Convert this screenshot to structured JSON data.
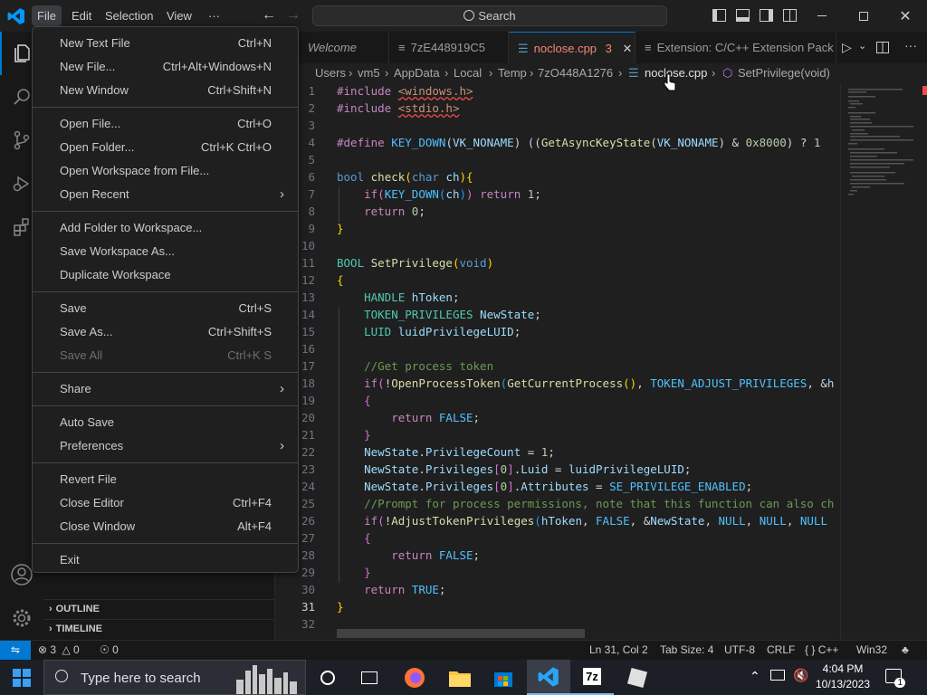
{
  "titlebar": {
    "menus": [
      "File",
      "Edit",
      "Selection",
      "View",
      "···"
    ],
    "search_label": "Search"
  },
  "sidebar": {
    "sections": [
      "OUTLINE",
      "TIMELINE"
    ]
  },
  "tabs": [
    {
      "label": "Welcome"
    },
    {
      "label": "7zE448919C5"
    },
    {
      "label": "noclose.cpp",
      "badge": "3"
    },
    {
      "label": "Extension: C/C++ Extension Pack"
    }
  ],
  "breadcrumb": [
    "Users",
    "vm5",
    "AppData",
    "Local",
    "Temp",
    "7zO448A1276",
    "noclose.cpp",
    "SetPrivilege(void)"
  ],
  "editor": {
    "line_numbers": [
      "1",
      "2",
      "3",
      "4",
      "5",
      "6",
      "7",
      "8",
      "9",
      "10",
      "11",
      "12",
      "13",
      "14",
      "15",
      "16",
      "17",
      "18",
      "19",
      "20",
      "21",
      "22",
      "23",
      "24",
      "25",
      "26",
      "27",
      "28",
      "29",
      "30",
      "31",
      "32"
    ],
    "current_line": "31",
    "lines": [
      [
        [
          "pp",
          "#include "
        ],
        [
          "st2 squig",
          "<windows.h>"
        ]
      ],
      [
        [
          "pp",
          "#include "
        ],
        [
          "st2 squig",
          "<stdio.h>"
        ]
      ],
      [],
      [
        [
          "pp",
          "#define "
        ],
        [
          "mac",
          "KEY_DOWN"
        ],
        [
          "op",
          "("
        ],
        [
          "va",
          "VK_NONAME"
        ],
        [
          "op",
          ") (("
        ],
        [
          "fn",
          "GetAsyncKeyState"
        ],
        [
          "op",
          "("
        ],
        [
          "va",
          "VK_NONAME"
        ],
        [
          "op",
          ") & "
        ],
        [
          "nu",
          "0x8000"
        ],
        [
          "op",
          ") ? "
        ],
        [
          "nu",
          "1"
        ]
      ],
      [],
      [
        [
          "kw",
          "bool "
        ],
        [
          "fn",
          "check"
        ],
        [
          "br",
          "("
        ],
        [
          "kw",
          "char "
        ],
        [
          "va",
          "ch"
        ],
        [
          "br",
          ")"
        ],
        [
          "br",
          "{"
        ]
      ],
      [
        [
          "op",
          "    "
        ],
        [
          "pp",
          "if"
        ],
        [
          "br2",
          "("
        ],
        [
          "mac",
          "KEY_DOWN"
        ],
        [
          "br3",
          "("
        ],
        [
          "va",
          "ch"
        ],
        [
          "br3",
          ")"
        ],
        [
          "br2",
          ")"
        ],
        [
          "pp",
          " return "
        ],
        [
          "nu",
          "1"
        ],
        [
          "op",
          ";"
        ]
      ],
      [
        [
          "op",
          "    "
        ],
        [
          "pp",
          "return "
        ],
        [
          "nu",
          "0"
        ],
        [
          "op",
          ";"
        ]
      ],
      [
        [
          "br",
          "}"
        ]
      ],
      [],
      [
        [
          "ty",
          "BOOL "
        ],
        [
          "fn",
          "SetPrivilege"
        ],
        [
          "br",
          "("
        ],
        [
          "kw",
          "void"
        ],
        [
          "br",
          ")"
        ]
      ],
      [
        [
          "br",
          "{"
        ]
      ],
      [
        [
          "op",
          "    "
        ],
        [
          "ty",
          "HANDLE "
        ],
        [
          "va",
          "hToken"
        ],
        [
          "op",
          ";"
        ]
      ],
      [
        [
          "op",
          "    "
        ],
        [
          "ty",
          "TOKEN_PRIVILEGES "
        ],
        [
          "va",
          "NewState"
        ],
        [
          "op",
          ";"
        ]
      ],
      [
        [
          "op",
          "    "
        ],
        [
          "ty",
          "LUID "
        ],
        [
          "va",
          "luidPrivilegeLUID"
        ],
        [
          "op",
          ";"
        ]
      ],
      [],
      [
        [
          "op",
          "    "
        ],
        [
          "cm",
          "//Get process token"
        ]
      ],
      [
        [
          "op",
          "    "
        ],
        [
          "pp",
          "if"
        ],
        [
          "br2",
          "("
        ],
        [
          "op",
          "!"
        ],
        [
          "fn",
          "OpenProcessToken"
        ],
        [
          "br3",
          "("
        ],
        [
          "fn",
          "GetCurrentProcess"
        ],
        [
          "br",
          "()"
        ],
        [
          "op",
          ", "
        ],
        [
          "mac",
          "TOKEN_ADJUST_PRIVILEGES"
        ],
        [
          "op",
          ", &"
        ],
        [
          "va",
          "h"
        ]
      ],
      [
        [
          "op",
          "    "
        ],
        [
          "br2",
          "{"
        ]
      ],
      [
        [
          "op",
          "        "
        ],
        [
          "pp",
          "return "
        ],
        [
          "mac",
          "FALSE"
        ],
        [
          "op",
          ";"
        ]
      ],
      [
        [
          "op",
          "    "
        ],
        [
          "br2",
          "}"
        ]
      ],
      [
        [
          "op",
          "    "
        ],
        [
          "va",
          "NewState"
        ],
        [
          "op",
          "."
        ],
        [
          "va",
          "PrivilegeCount"
        ],
        [
          "op",
          " = "
        ],
        [
          "nu",
          "1"
        ],
        [
          "op",
          ";"
        ]
      ],
      [
        [
          "op",
          "    "
        ],
        [
          "va",
          "NewState"
        ],
        [
          "op",
          "."
        ],
        [
          "va",
          "Privileges"
        ],
        [
          "br2",
          "["
        ],
        [
          "nu",
          "0"
        ],
        [
          "br2",
          "]"
        ],
        [
          "op",
          "."
        ],
        [
          "va",
          "Luid"
        ],
        [
          "op",
          " = "
        ],
        [
          "va",
          "luidPrivilegeLUID"
        ],
        [
          "op",
          ";"
        ]
      ],
      [
        [
          "op",
          "    "
        ],
        [
          "va",
          "NewState"
        ],
        [
          "op",
          "."
        ],
        [
          "va",
          "Privileges"
        ],
        [
          "br2",
          "["
        ],
        [
          "nu",
          "0"
        ],
        [
          "br2",
          "]"
        ],
        [
          "op",
          "."
        ],
        [
          "va",
          "Attributes"
        ],
        [
          "op",
          " = "
        ],
        [
          "mac",
          "SE_PRIVILEGE_ENABLED"
        ],
        [
          "op",
          ";"
        ]
      ],
      [
        [
          "op",
          "    "
        ],
        [
          "cm",
          "//Prompt for process permissions, note that this function can also ch"
        ]
      ],
      [
        [
          "op",
          "    "
        ],
        [
          "pp",
          "if"
        ],
        [
          "br2",
          "("
        ],
        [
          "op",
          "!"
        ],
        [
          "fn",
          "AdjustTokenPrivileges"
        ],
        [
          "br3",
          "("
        ],
        [
          "va",
          "hToken"
        ],
        [
          "op",
          ", "
        ],
        [
          "mac",
          "FALSE"
        ],
        [
          "op",
          ", &"
        ],
        [
          "va",
          "NewState"
        ],
        [
          "op",
          ", "
        ],
        [
          "mac",
          "NULL"
        ],
        [
          "op",
          ", "
        ],
        [
          "mac",
          "NULL"
        ],
        [
          "op",
          ", "
        ],
        [
          "mac",
          "NULL"
        ]
      ],
      [
        [
          "op",
          "    "
        ],
        [
          "br2",
          "{"
        ]
      ],
      [
        [
          "op",
          "        "
        ],
        [
          "pp",
          "return "
        ],
        [
          "mac",
          "FALSE"
        ],
        [
          "op",
          ";"
        ]
      ],
      [
        [
          "op",
          "    "
        ],
        [
          "br2",
          "}"
        ]
      ],
      [
        [
          "op",
          "    "
        ],
        [
          "pp",
          "return "
        ],
        [
          "mac",
          "TRUE"
        ],
        [
          "op",
          ";"
        ]
      ],
      [
        [
          "br",
          "}"
        ]
      ],
      []
    ]
  },
  "file_menu": {
    "groups": [
      [
        {
          "label": "New Text File",
          "shortcut": "Ctrl+N"
        },
        {
          "label": "New File...",
          "shortcut": "Ctrl+Alt+Windows+N"
        },
        {
          "label": "New Window",
          "shortcut": "Ctrl+Shift+N"
        }
      ],
      [
        {
          "label": "Open File...",
          "shortcut": "Ctrl+O"
        },
        {
          "label": "Open Folder...",
          "shortcut": "Ctrl+K Ctrl+O"
        },
        {
          "label": "Open Workspace from File...",
          "shortcut": ""
        },
        {
          "label": "Open Recent",
          "shortcut": "",
          "submenu": true
        }
      ],
      [
        {
          "label": "Add Folder to Workspace...",
          "shortcut": ""
        },
        {
          "label": "Save Workspace As...",
          "shortcut": ""
        },
        {
          "label": "Duplicate Workspace",
          "shortcut": ""
        }
      ],
      [
        {
          "label": "Save",
          "shortcut": "Ctrl+S"
        },
        {
          "label": "Save As...",
          "shortcut": "Ctrl+Shift+S"
        },
        {
          "label": "Save All",
          "shortcut": "Ctrl+K S",
          "disabled": true
        }
      ],
      [
        {
          "label": "Share",
          "shortcut": "",
          "submenu": true
        }
      ],
      [
        {
          "label": "Auto Save",
          "shortcut": ""
        },
        {
          "label": "Preferences",
          "shortcut": "",
          "submenu": true
        }
      ],
      [
        {
          "label": "Revert File",
          "shortcut": ""
        },
        {
          "label": "Close Editor",
          "shortcut": "Ctrl+F4"
        },
        {
          "label": "Close Window",
          "shortcut": "Alt+F4"
        }
      ],
      [
        {
          "label": "Exit",
          "shortcut": ""
        }
      ]
    ]
  },
  "statusbar": {
    "errors": "3",
    "warnings": "0",
    "ports": "0",
    "position": "Ln 31, Col 2",
    "tab_size": "Tab Size: 4",
    "encoding": "UTF-8",
    "eol": "CRLF",
    "language": "C++",
    "platform": "Win32"
  },
  "taskbar": {
    "search_placeholder": "Type here to search",
    "time": "4:04 PM",
    "date": "10/13/2023",
    "notification_count": "1"
  },
  "colors": {
    "accent": "#0078d4",
    "tab_active_text": "#f48771",
    "statusbar_remote": "#0078d4"
  }
}
